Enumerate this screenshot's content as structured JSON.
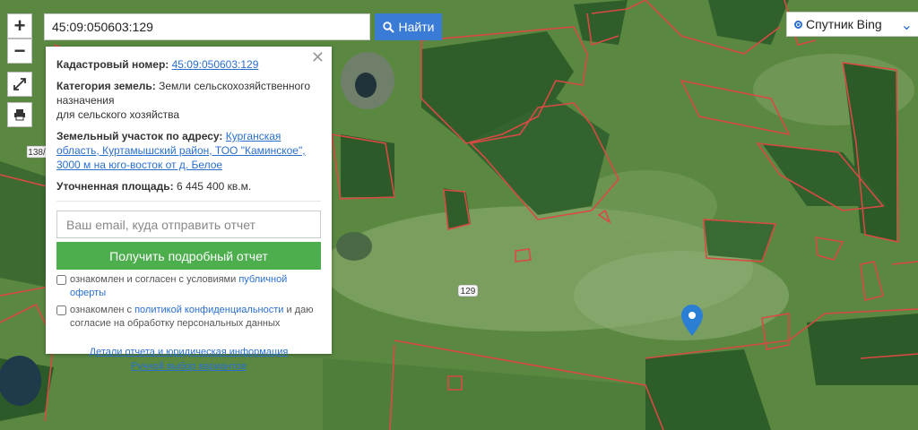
{
  "map": {
    "label_129": "129",
    "label_138": "138/",
    "colors": {
      "field": "#58843f",
      "forest": "#2f5e2a",
      "boundary": "#d84a43",
      "water": "#1f3a4a"
    }
  },
  "controls": {
    "zoom_in": "+",
    "zoom_out": "−"
  },
  "search": {
    "value": "45:09:050603:129",
    "button_label": "Найти"
  },
  "layer": {
    "selected": "Спутник Bing"
  },
  "popup": {
    "cadastral_label": "Кадастровый номер:",
    "cadastral_value": "45:09:050603:129",
    "category_label": "Категория земель:",
    "category_value": "Земли сельскохозяйственного назначения",
    "category_value2": "для сельского хозяйства",
    "address_label": "Земельный участок по адресу:",
    "address_value": "Курганская область, Куртамышский район, ТОО \"Каминское\", 3000 м на юго-восток от д. Белое",
    "area_label": "Уточненная площадь:",
    "area_value": "6 445 400 кв.м.",
    "email_placeholder": "Ваш email, куда отправить отчет",
    "report_button": "Получить подробный отчет",
    "check1_text": "ознакомлен и согласен с условиями ",
    "check1_link": "публичной оферты",
    "check2_text": "ознакомлен с ",
    "check2_link": "политикой конфиденциальности",
    "check2_text2": " и даю согласие на обработку персональных данных",
    "details_link": "Детали отчета и юридическая информация",
    "manual_link": "Ручной выбор вариантов"
  }
}
